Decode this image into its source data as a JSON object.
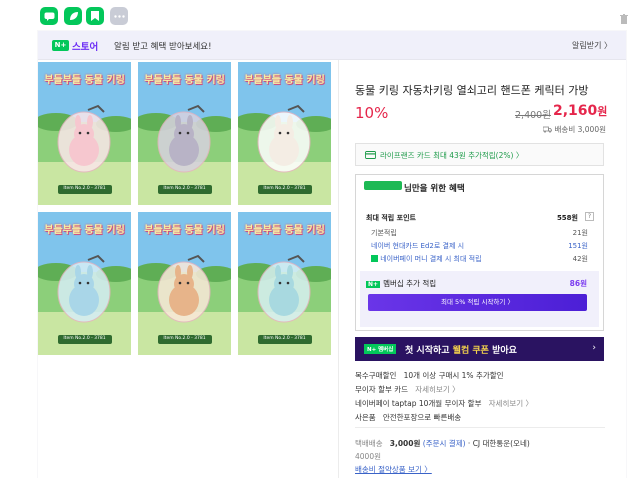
{
  "banner": {
    "badge": "N+",
    "store": "스토어",
    "text": "알림 받고 혜택 받아보세요!",
    "alarm": "알림받기 〉"
  },
  "product": {
    "title": "동물 키링 자동차키링 열쇠고리 핸드폰 케릭터 가방",
    "discount": "10%",
    "original_price": "2,400원",
    "price": "2,160",
    "price_unit": "원",
    "shipping": "배송비 3,000원"
  },
  "card_offer": "라이프랜즈 카드 최대 43원 추가적립(2%) 〉",
  "benefit": {
    "heading": "님만을 위한 혜택",
    "max_points_label": "최대 적립 포인트",
    "max_points_value": "558원",
    "rows": [
      {
        "label": "기본적립",
        "value": "21원"
      },
      {
        "label": "네이버 현대카드 Ed2로 결제 시",
        "value": "151원"
      },
      {
        "label": "네이버페이 머니 결제 시 최대 적립",
        "value": "42원"
      }
    ],
    "membership_label": "멤버십 추가 적립",
    "membership_value": "86원",
    "membership_button": "최대 5% 적립 시작하기 〉"
  },
  "promo": {
    "badge": "N+ 멤버십",
    "text_a": "첫 시작하고 ",
    "text_b": "웰컴 쿠폰",
    "text_c": " 받아요"
  },
  "details": [
    {
      "label": "복수구매할인",
      "value": "10개 이상 구매시 1% 추가할인",
      "link": ""
    },
    {
      "label": "무이자 할부 카드",
      "value": "",
      "link": "자세히보기 〉"
    },
    {
      "label": "네이버페이 taptap 10개월 무이자 할부",
      "value": "",
      "link": "자세히보기 〉"
    },
    {
      "label": "사은품",
      "value": "안전한포장으로 빠른배송",
      "link": ""
    }
  ],
  "delivery": {
    "label": "택배배송",
    "fee": "3,000원",
    "condition": "(주문시 결제)",
    "carrier": "· CJ 대한통운(오네)",
    "extra": "4000원",
    "link": "배송비 절약상품 보기 〉"
  },
  "gallery": {
    "heading": "부들부들 동물 키링",
    "caption": "Item No.2.0 - 3781",
    "animals": [
      "pink-bunny",
      "grey-bunny",
      "white-dog",
      "blue-bunny",
      "shiba-dog",
      "blue-cat"
    ]
  },
  "colors": {
    "accent": "#e5264b",
    "naver_green": "#03c75a",
    "purple": "#6b2cf5"
  }
}
